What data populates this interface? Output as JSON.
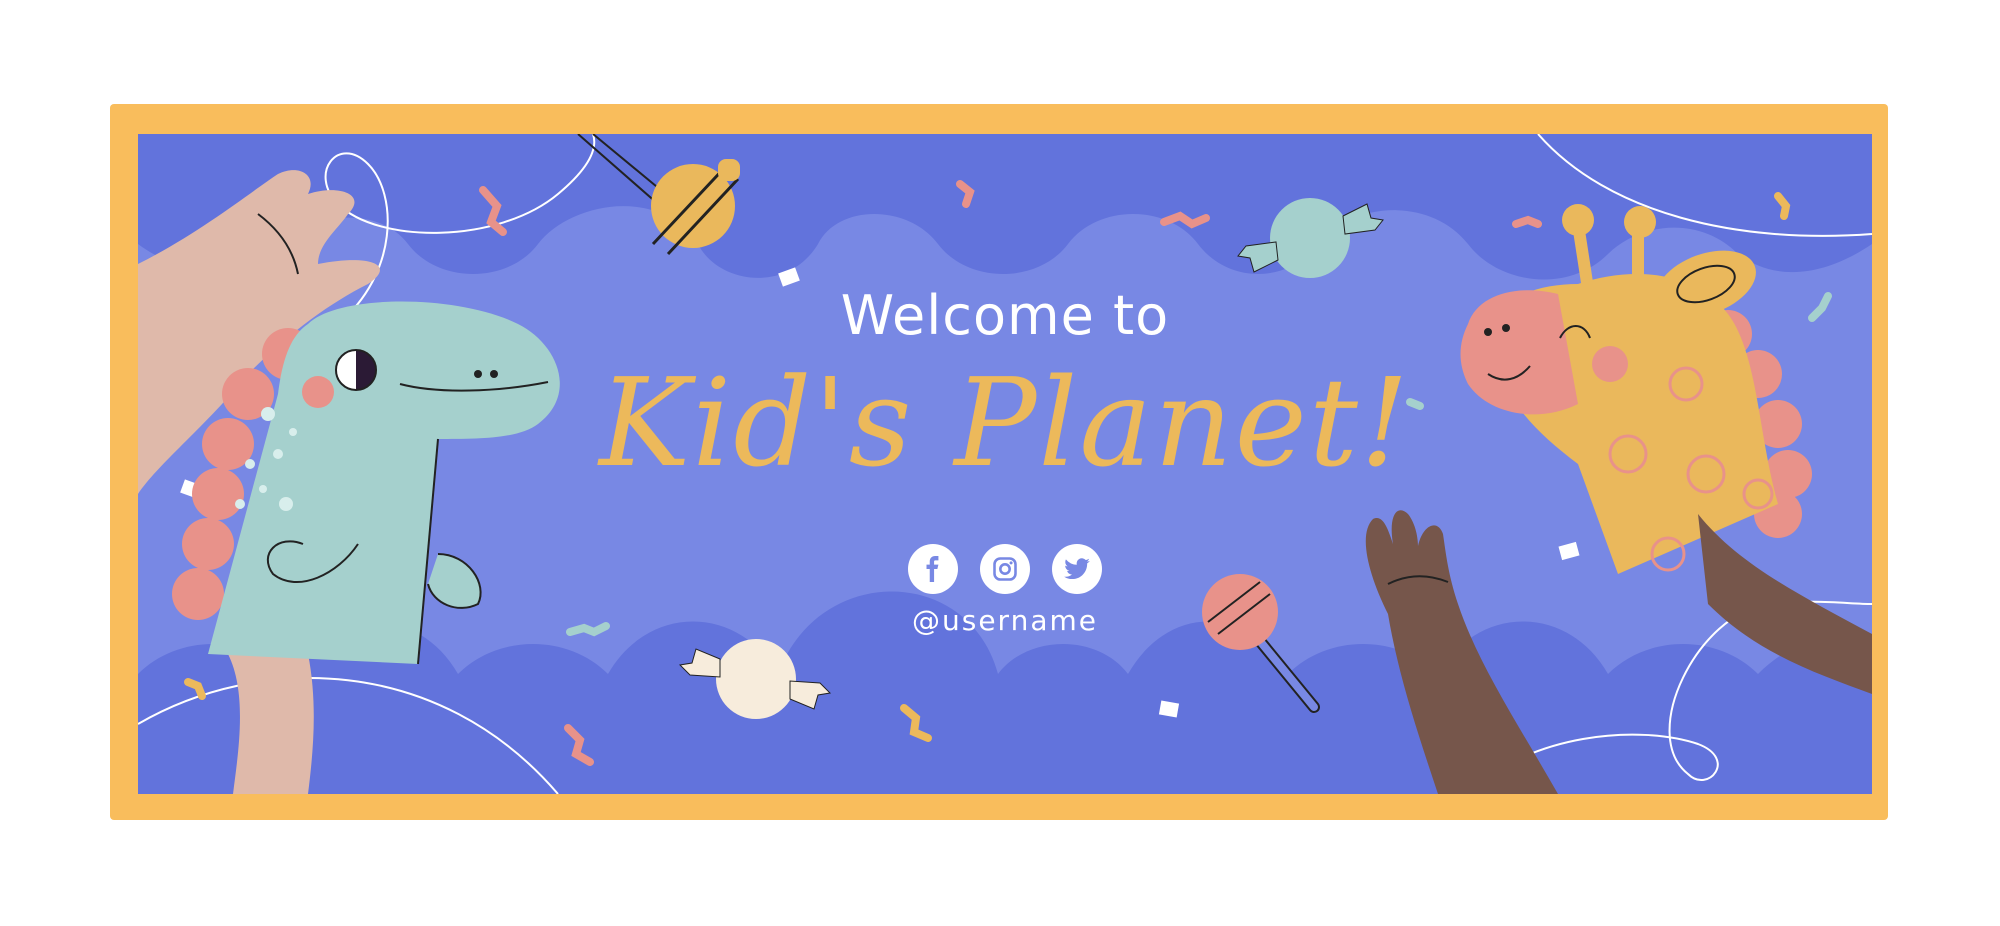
{
  "banner": {
    "welcome_text": "Welcome to",
    "title": "Kid's Planet!",
    "username": "@username",
    "social_icons": [
      "facebook-icon",
      "instagram-icon",
      "twitter-icon"
    ]
  },
  "colors": {
    "frame": "#f9bd5c",
    "background": "#7888e4",
    "cloud": "#6273dc",
    "title": "#ecb95b",
    "dino": "#a5d0cd",
    "giraffe": "#eab85c",
    "accent_pink": "#e8928a"
  }
}
